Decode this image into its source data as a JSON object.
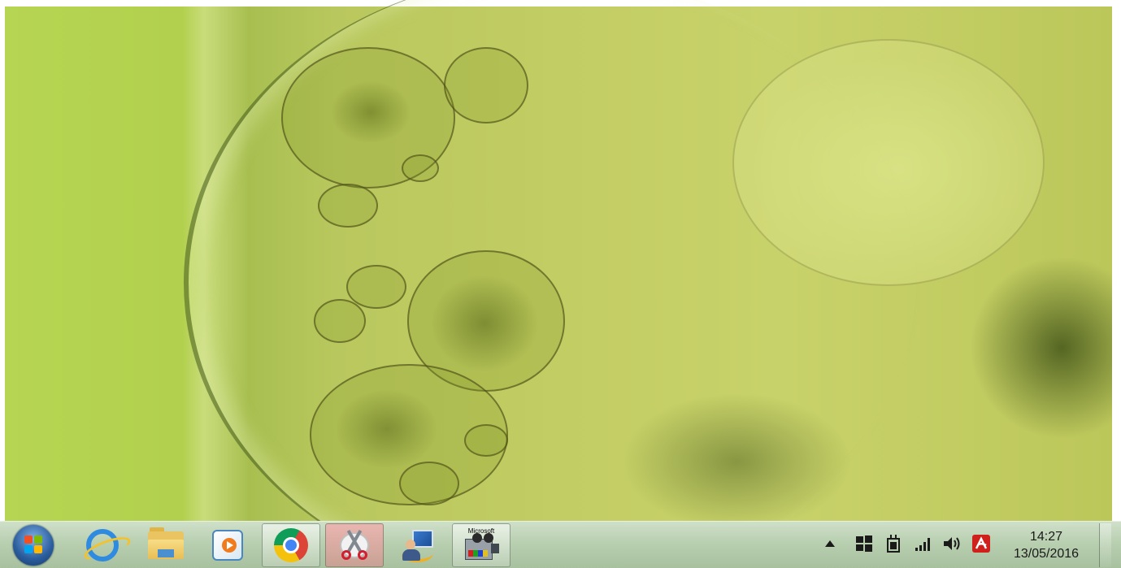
{
  "taskbar": {
    "start_button": {
      "icon": "windows-start-orb"
    },
    "pinned": [
      {
        "name": "internet-explorer",
        "icon": "internet-explorer-icon",
        "active": false
      },
      {
        "name": "windows-explorer",
        "icon": "folder-icon",
        "active": false
      },
      {
        "name": "media-player",
        "icon": "media-player-icon",
        "active": false
      },
      {
        "name": "google-chrome",
        "icon": "chrome-icon",
        "active": true
      },
      {
        "name": "snipping-tool",
        "icon": "snipping-tool-icon",
        "active": true
      },
      {
        "name": "user-app",
        "icon": "user-app-icon",
        "active": false
      },
      {
        "name": "movie-maker",
        "icon": "movie-maker-icon",
        "label": "Microsoft",
        "active": true
      }
    ],
    "tray": {
      "icons": [
        "show-hidden-icons-arrow",
        "windows-flag-icon",
        "power-plug-icon",
        "signal-bars-icon",
        "volume-icon",
        "avira-icon"
      ],
      "time": "14:27",
      "date": "13/05/2016"
    }
  },
  "colors": {
    "taskbar_bg": "#b8cfb0",
    "wallpaper_main": "#c2cd63",
    "avira_red": "#d0201c"
  }
}
